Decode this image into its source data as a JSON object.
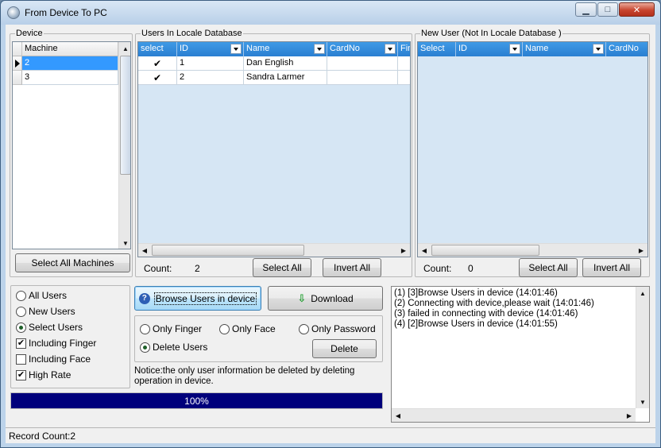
{
  "window": {
    "title": "From Device To PC",
    "minimize_glyph": "▁",
    "maximize_glyph": "□",
    "close_glyph": "✕"
  },
  "device": {
    "group_label": "Device",
    "column": "Machine",
    "rows": [
      "2",
      "3"
    ],
    "selected_index": 0,
    "select_all_label": "Select All Machines"
  },
  "users_local": {
    "group_label": "Users In Locale Database",
    "columns": [
      "select",
      "ID",
      "Name",
      "CardNo",
      "Fin"
    ],
    "rows": [
      {
        "selected": true,
        "id": "1",
        "name": "Dan English",
        "cardno": ""
      },
      {
        "selected": true,
        "id": "2",
        "name": "Sandra Larmer",
        "cardno": ""
      }
    ],
    "count_label": "Count:",
    "count_value": "2",
    "select_all_label": "Select All",
    "invert_all_label": "Invert All"
  },
  "new_users": {
    "group_label": "New User (Not In Locale Database )",
    "columns": [
      "Select",
      "ID",
      "Name",
      "CardNo"
    ],
    "count_label": "Count:",
    "count_value": "0",
    "select_all_label": "Select All",
    "invert_all_label": "Invert All"
  },
  "filter_options": [
    {
      "label": "All Users",
      "type": "radio",
      "checked": false
    },
    {
      "label": "New Users",
      "type": "radio",
      "checked": false
    },
    {
      "label": "Select Users",
      "type": "radio",
      "checked": true
    },
    {
      "label": "Including Finger",
      "type": "checkbox",
      "checked": true
    },
    {
      "label": "Including Face",
      "type": "checkbox",
      "checked": false
    },
    {
      "label": "High Rate",
      "type": "checkbox",
      "checked": true
    }
  ],
  "actions": {
    "browse_label": "Browse Users in device",
    "download_label": "Download"
  },
  "delete_options": {
    "only_finger": "Only Finger",
    "only_face": "Only Face",
    "only_password": "Only Password",
    "delete_users": "Delete Users",
    "selected": "delete_users",
    "delete_button": "Delete",
    "notice": "Notice:the only user information be deleted by deleting operation in device."
  },
  "log": {
    "lines": [
      "(1) [3]Browse Users in device (14:01:46)",
      "(2) Connecting with device,please wait (14:01:46)",
      "(3) failed in connecting with device (14:01:46)",
      "(4) [2]Browse Users in device (14:01:55)"
    ]
  },
  "progress": {
    "value": 100,
    "label": "100%",
    "color": "#00007b"
  },
  "status": {
    "record_count": "Record Count:2"
  },
  "colors": {
    "grid_header": "#2a7fd1",
    "grid_bg": "#d6e6f4",
    "selection": "#3399ff"
  }
}
